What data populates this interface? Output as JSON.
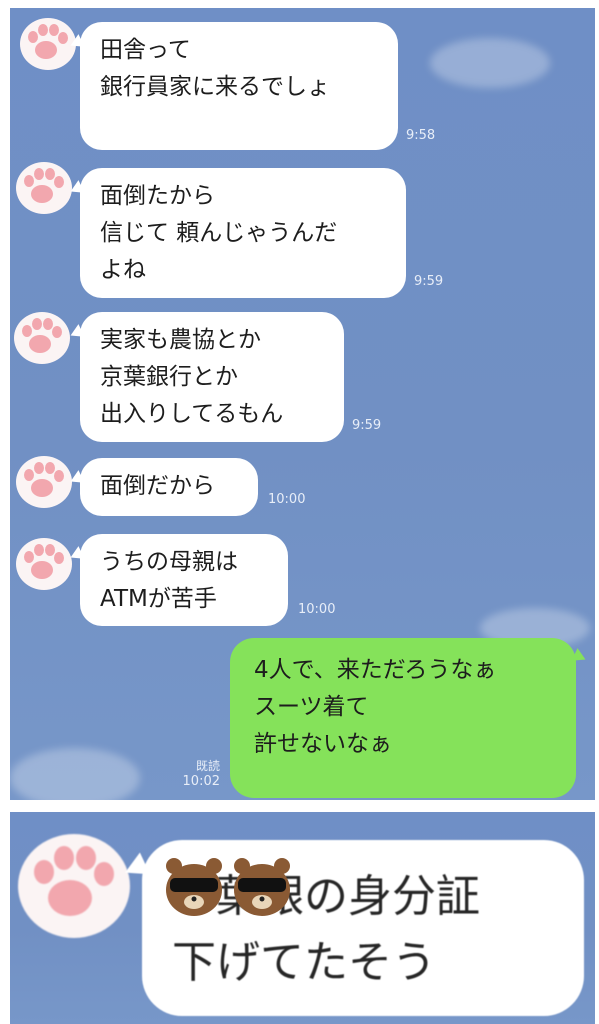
{
  "messages": [
    {
      "lines": [
        "田舎って",
        "銀行員家に来るでしょ"
      ],
      "time": "9:58"
    },
    {
      "lines": [
        "面倒たから",
        "信じて 頼んじゃうんだ",
        "よね"
      ],
      "time": "9:59"
    },
    {
      "lines": [
        "実家も農協とか",
        "京葉銀行とか",
        "出入りしてるもん"
      ],
      "time": "9:59"
    },
    {
      "lines": [
        "面倒だから"
      ],
      "time": "10:00"
    },
    {
      "lines": [
        "うちの母親は",
        "ATMが苦手"
      ],
      "time": "10:00"
    }
  ],
  "sent_message": {
    "lines": [
      "4人で、来ただろうなぁ",
      "スーツ着て",
      "許せないなぁ"
    ],
    "read_label": "既読",
    "time": "10:02"
  },
  "zoomed_message": {
    "lines": [
      "千葉銀の身分証",
      "下げてたそう"
    ]
  },
  "colors": {
    "background": "#7190c4",
    "incoming_bubble": "#ffffff",
    "outgoing_bubble": "#85e25a",
    "paw_pad": "#f2a7ae"
  },
  "icons": {
    "avatar": "cat-paw-icon",
    "sticker": "bear-sunglasses-icon"
  }
}
